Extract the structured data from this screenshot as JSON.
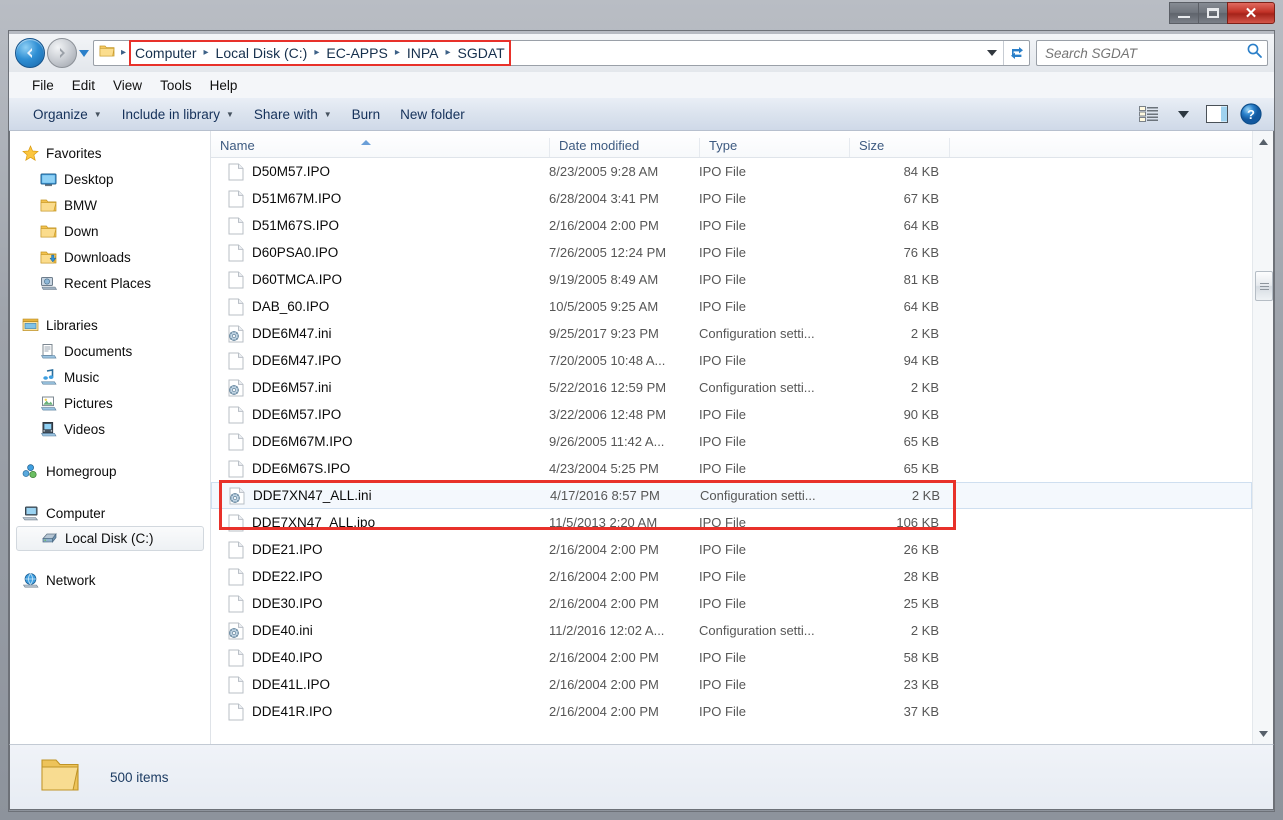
{
  "window": {
    "title": "",
    "controls": {
      "minimize": "minimize-button",
      "maximize": "maximize-button",
      "close": "✕"
    }
  },
  "address": {
    "crumbs": [
      "Computer",
      "Local Disk (C:)",
      "EC-APPS",
      "INPA",
      "SGDAT"
    ],
    "separator": "▸",
    "highlight_color": "#e8312a"
  },
  "search": {
    "placeholder": "Search SGDAT",
    "value": ""
  },
  "menubar": {
    "items": [
      "File",
      "Edit",
      "View",
      "Tools",
      "Help"
    ]
  },
  "toolbar": {
    "items": [
      {
        "label": "Organize",
        "caret": true
      },
      {
        "label": "Include in library",
        "caret": true
      },
      {
        "label": "Share with",
        "caret": true
      },
      {
        "label": "Burn",
        "caret": false
      },
      {
        "label": "New folder",
        "caret": false
      }
    ],
    "view_button": "change-view",
    "view_caret": "▾",
    "preview_button": "show-preview-pane",
    "help_button": "help"
  },
  "sidebar": {
    "groups": [
      {
        "root": {
          "label": "Favorites",
          "icon": "star-icon"
        },
        "items": [
          {
            "label": "Desktop",
            "icon": "desktop-icon"
          },
          {
            "label": "BMW",
            "icon": "folder-icon"
          },
          {
            "label": "Down",
            "icon": "folder-icon"
          },
          {
            "label": "Downloads",
            "icon": "downloads-folder-icon"
          },
          {
            "label": "Recent Places",
            "icon": "recent-places-icon"
          }
        ]
      },
      {
        "root": {
          "label": "Libraries",
          "icon": "libraries-icon"
        },
        "items": [
          {
            "label": "Documents",
            "icon": "documents-icon"
          },
          {
            "label": "Music",
            "icon": "music-icon"
          },
          {
            "label": "Pictures",
            "icon": "pictures-icon"
          },
          {
            "label": "Videos",
            "icon": "videos-icon"
          }
        ]
      },
      {
        "root": {
          "label": "Homegroup",
          "icon": "homegroup-icon"
        },
        "items": []
      },
      {
        "root": {
          "label": "Computer",
          "icon": "computer-icon"
        },
        "items": [
          {
            "label": "Local Disk (C:)",
            "icon": "hard-disk-icon",
            "selected": true
          }
        ]
      },
      {
        "root": {
          "label": "Network",
          "icon": "network-icon"
        },
        "items": []
      }
    ]
  },
  "filelist": {
    "columns": [
      "Name",
      "Date modified",
      "Type",
      "Size"
    ],
    "sorted_by": "Name",
    "sort_direction": "ascending",
    "rows": [
      {
        "name": "D50M57.IPO",
        "date": "8/23/2005 9:28 AM",
        "type": "IPO File",
        "size": "84 KB",
        "icon": "generic-file-icon"
      },
      {
        "name": "D51M67M.IPO",
        "date": "6/28/2004 3:41 PM",
        "type": "IPO File",
        "size": "67 KB",
        "icon": "generic-file-icon"
      },
      {
        "name": "D51M67S.IPO",
        "date": "2/16/2004 2:00 PM",
        "type": "IPO File",
        "size": "64 KB",
        "icon": "generic-file-icon"
      },
      {
        "name": "D60PSA0.IPO",
        "date": "7/26/2005 12:24 PM",
        "type": "IPO File",
        "size": "76 KB",
        "icon": "generic-file-icon"
      },
      {
        "name": "D60TMCA.IPO",
        "date": "9/19/2005 8:49 AM",
        "type": "IPO File",
        "size": "81 KB",
        "icon": "generic-file-icon"
      },
      {
        "name": "DAB_60.IPO",
        "date": "10/5/2005 9:25 AM",
        "type": "IPO File",
        "size": "64 KB",
        "icon": "generic-file-icon"
      },
      {
        "name": "DDE6M47.ini",
        "date": "9/25/2017 9:23 PM",
        "type": "Configuration setti...",
        "size": "2 KB",
        "icon": "ini-file-icon"
      },
      {
        "name": "DDE6M47.IPO",
        "date": "7/20/2005 10:48 A...",
        "type": "IPO File",
        "size": "94 KB",
        "icon": "generic-file-icon"
      },
      {
        "name": "DDE6M57.ini",
        "date": "5/22/2016 12:59 PM",
        "type": "Configuration setti...",
        "size": "2 KB",
        "icon": "ini-file-icon"
      },
      {
        "name": "DDE6M57.IPO",
        "date": "3/22/2006 12:48 PM",
        "type": "IPO File",
        "size": "90 KB",
        "icon": "generic-file-icon"
      },
      {
        "name": "DDE6M67M.IPO",
        "date": "9/26/2005 11:42 A...",
        "type": "IPO File",
        "size": "65 KB",
        "icon": "generic-file-icon"
      },
      {
        "name": "DDE6M67S.IPO",
        "date": "4/23/2004 5:25 PM",
        "type": "IPO File",
        "size": "65 KB",
        "icon": "generic-file-icon"
      },
      {
        "name": "DDE7XN47_ALL.ini",
        "date": "4/17/2016 8:57 PM",
        "type": "Configuration setti...",
        "size": "2 KB",
        "icon": "ini-file-icon",
        "selected": true
      },
      {
        "name": "DDE7XN47_ALL.ipo",
        "date": "11/5/2013 2:20 AM",
        "type": "IPO File",
        "size": "106 KB",
        "icon": "generic-file-icon",
        "highlighted": true
      },
      {
        "name": "DDE21.IPO",
        "date": "2/16/2004 2:00 PM",
        "type": "IPO File",
        "size": "26 KB",
        "icon": "generic-file-icon"
      },
      {
        "name": "DDE22.IPO",
        "date": "2/16/2004 2:00 PM",
        "type": "IPO File",
        "size": "28 KB",
        "icon": "generic-file-icon"
      },
      {
        "name": "DDE30.IPO",
        "date": "2/16/2004 2:00 PM",
        "type": "IPO File",
        "size": "25 KB",
        "icon": "generic-file-icon"
      },
      {
        "name": "DDE40.ini",
        "date": "11/2/2016 12:02 A...",
        "type": "Configuration setti...",
        "size": "2 KB",
        "icon": "ini-file-icon"
      },
      {
        "name": "DDE40.IPO",
        "date": "2/16/2004 2:00 PM",
        "type": "IPO File",
        "size": "58 KB",
        "icon": "generic-file-icon"
      },
      {
        "name": "DDE41L.IPO",
        "date": "2/16/2004 2:00 PM",
        "type": "IPO File",
        "size": "23 KB",
        "icon": "generic-file-icon"
      },
      {
        "name": "DDE41R.IPO",
        "date": "2/16/2004 2:00 PM",
        "type": "IPO File",
        "size": "37 KB",
        "icon": "generic-file-icon"
      }
    ]
  },
  "statusbar": {
    "item_count": "500 items",
    "icon": "folder-icon"
  }
}
